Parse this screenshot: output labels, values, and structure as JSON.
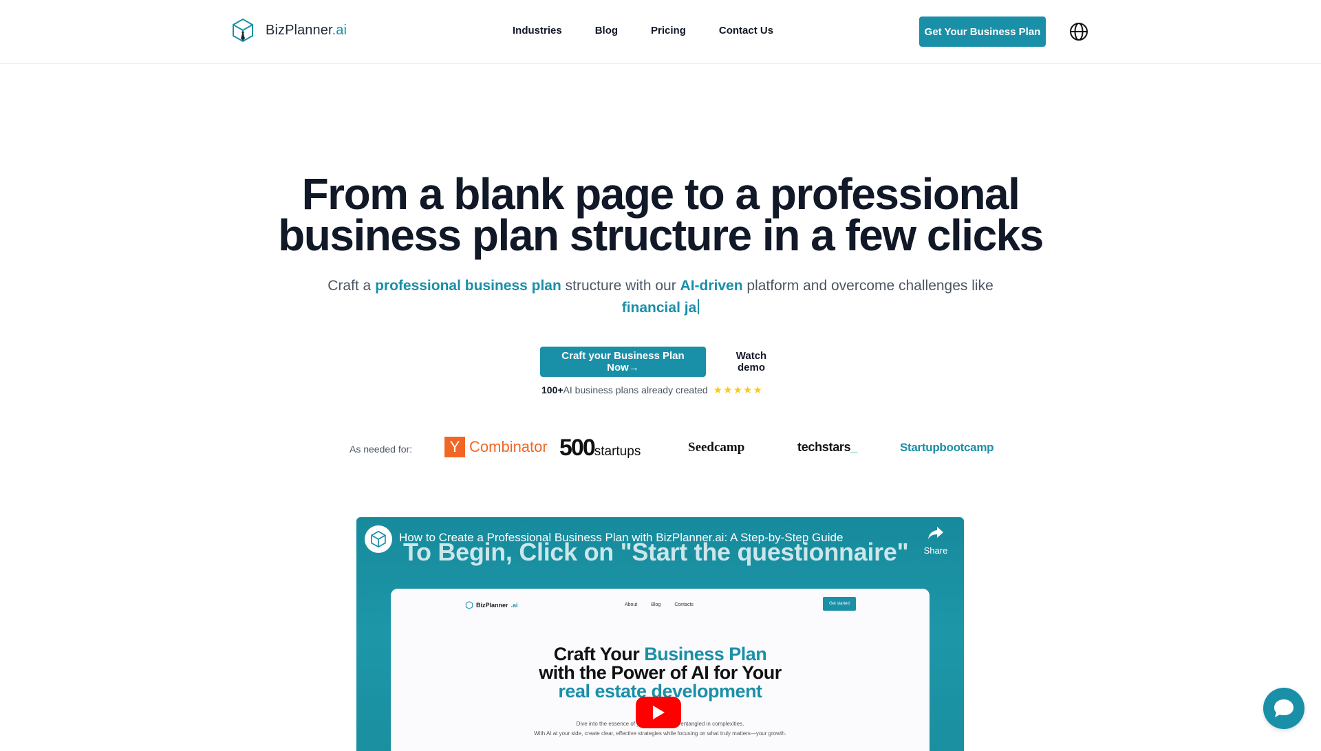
{
  "header": {
    "logo_main": "BizPlanner",
    "logo_suffix": ".ai",
    "nav": [
      "Industries",
      "Blog",
      "Pricing",
      "Contact Us"
    ],
    "cta": "Get Your Business Plan"
  },
  "hero": {
    "title_line1": "From a blank page to a professional",
    "title_line2": "business plan structure in a few clicks",
    "sub_part1": "Craft a ",
    "sub_highlight1": "professional business plan",
    "sub_part2": " structure with our ",
    "sub_highlight2": "AI-driven",
    "sub_part3": " platform and overcome challenges like",
    "typed_text": "financial ja",
    "primary_button": "Craft your Business Plan Now→",
    "demo_button": "Watch demo",
    "proof_count": "100+",
    "proof_text": "AI business plans already created",
    "rating_stars": 5
  },
  "needed_for": {
    "label": "As needed for:",
    "brands": {
      "yc_mark": "Y",
      "yc_text": "Combinator",
      "b500_big": "500",
      "b500_small": "startups",
      "seedcamp": "Seedcamp",
      "techstars": "techstars",
      "techstars_mark": "_",
      "startupbootcamp": "Startupbootcamp"
    }
  },
  "video": {
    "title": "How to Create a Professional Business Plan with BizPlanner.ai: A Step-by-Step Guide",
    "caption": "To Begin, Click  on \"Start the questionnaire\"",
    "share_label": "Share",
    "frame": {
      "logo_main": "BizPlanner",
      "logo_suffix": ".ai",
      "nav": [
        "About",
        "Blog",
        "Contacts"
      ],
      "cta": "Get started",
      "headline_part1": "Craft Your ",
      "headline_highlight1": "Business Plan",
      "headline_line2": "with the Power of AI for Your",
      "headline_highlight2": "real estate development",
      "body_line1": "Dive into the essence of your bu... ...etting entangled in complexities.",
      "body_line2": "With AI at your side, create clear, effective strategies while focusing on what truly matters—your growth."
    }
  },
  "colors": {
    "accent": "#1a8fa8",
    "text_dark": "#111827",
    "text_muted": "#4b5563",
    "star": "#facc15",
    "yc_orange": "#f26625",
    "youtube_red": "#ff0000"
  },
  "icons": {
    "logo": "cube-logo-icon",
    "language": "globe-icon",
    "star": "star-icon",
    "share": "share-arrow-icon",
    "play": "play-icon",
    "chat": "chat-bubble-icon"
  }
}
